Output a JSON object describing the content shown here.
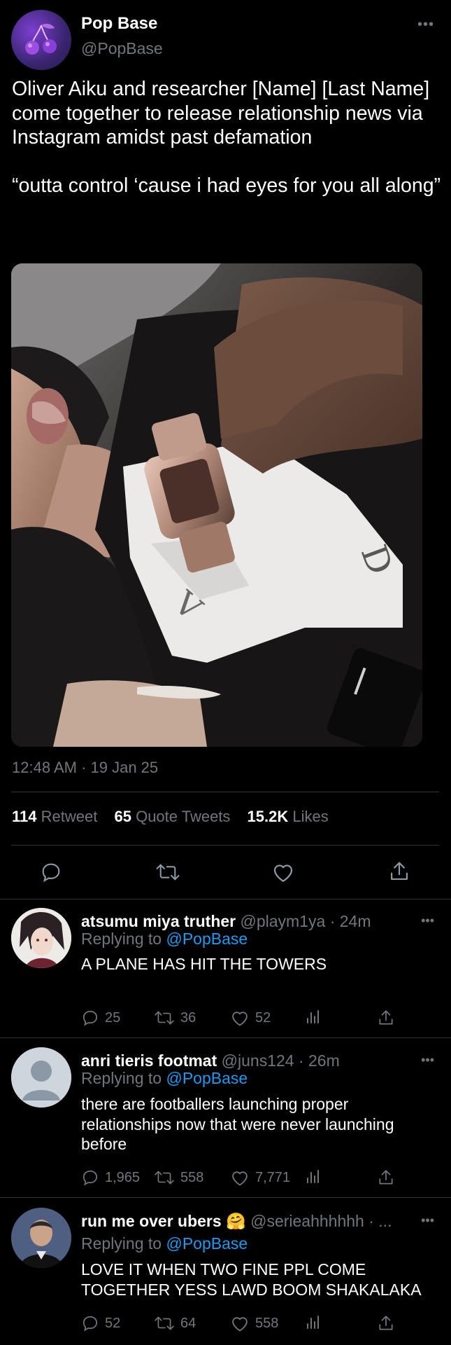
{
  "tweet": {
    "author_name": "Pop Base",
    "author_handle": "@PopBase",
    "text": "Oliver Aiku and researcher [Name] [Last Name] come together to release relationship news via Instagram amidst past defamation\n\n“outta control ‘cause i had eyes for you all along”",
    "timestamp": "12:48 AM · 19 Jan 25",
    "stats": {
      "retweet_count": "114",
      "retweet_label": "Retweet",
      "quote_count": "65",
      "quote_label": "Quote Tweets",
      "likes_count": "15.2K",
      "likes_label": "Likes"
    },
    "more_icon": "more-icon"
  },
  "replies": [
    {
      "name": "atsumu miya truther",
      "handle": "@playm1ya",
      "time": "· 24m",
      "replying_prefix": "Replying to",
      "replying_mention": "@PopBase",
      "text": "A PLANE HAS HIT THE TOWERS",
      "replies": "25",
      "retweets": "36",
      "likes": "52"
    },
    {
      "name": "anri tieris footmat",
      "handle": "@juns124",
      "time": "· 26m",
      "replying_prefix": "Replying to",
      "replying_mention": "@PopBase",
      "text": "there are footballers launching proper relationships now that were never launching before",
      "replies": "1,965",
      "retweets": "558",
      "likes": "7,771"
    },
    {
      "name": "run me over ubers 🤗",
      "handle": "@serieahhhhhh · ...",
      "time": "",
      "replying_prefix": "Replying to",
      "replying_mention": "@PopBase",
      "text": "LOVE IT WHEN TWO FINE PPL COME TOGETHER YESS LAWD BOOM SHAKALAKA",
      "replies": "52",
      "retweets": "64",
      "likes": "558"
    }
  ],
  "colors": {
    "background": "#000000",
    "text": "#e7e9ea",
    "secondary": "#71767b",
    "accent": "#1d9bf0",
    "divider": "#2f3336"
  },
  "icons": [
    "reply-icon",
    "retweet-icon",
    "like-icon",
    "share-icon",
    "views-icon",
    "more-icon",
    "cherry-logo-icon"
  ]
}
